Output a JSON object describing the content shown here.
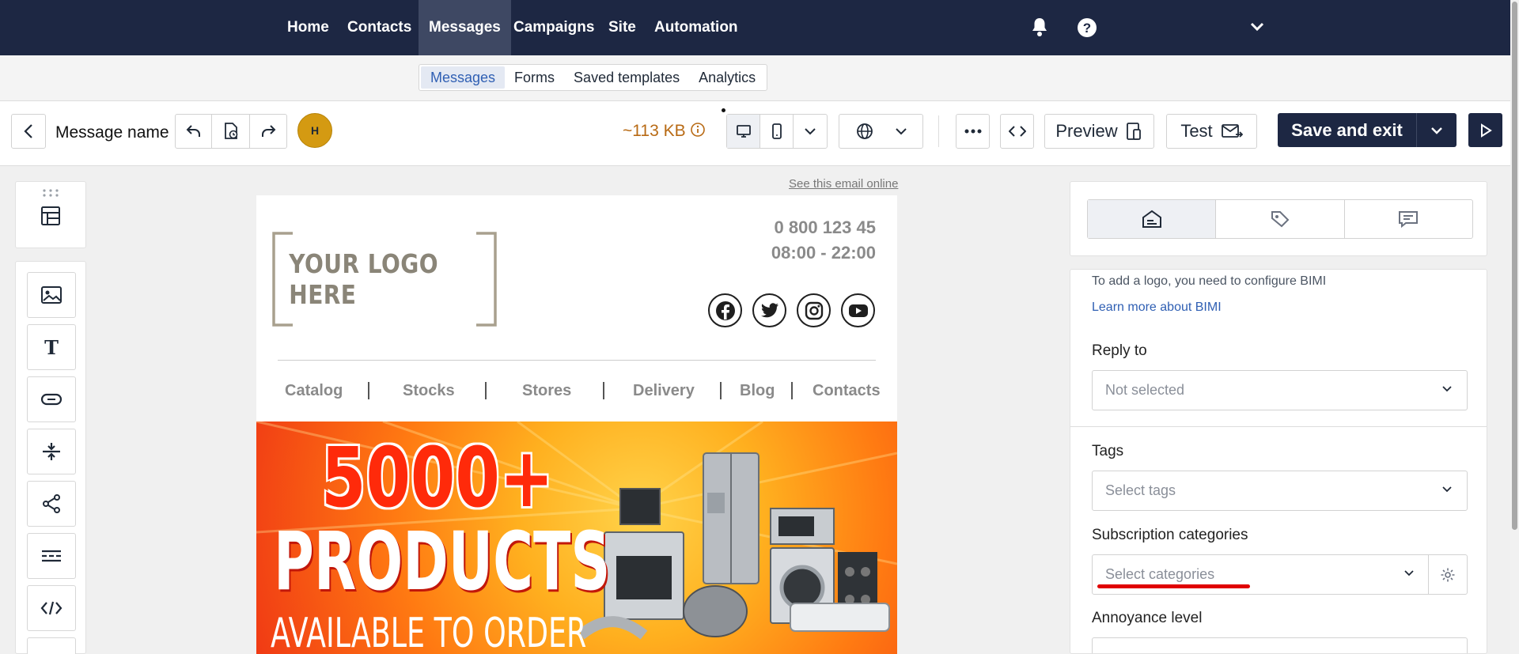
{
  "nav": {
    "items": [
      "Home",
      "Contacts",
      "Messages",
      "Campaigns",
      "Site",
      "Automation"
    ],
    "active": "Messages"
  },
  "subnav": {
    "items": [
      "Messages",
      "Forms",
      "Saved templates",
      "Analytics"
    ],
    "active": "Messages"
  },
  "toolbar": {
    "message_name": "Message name",
    "avatar_initial": "H",
    "size": "~113 KB",
    "preview_label": "Preview",
    "test_label": "Test",
    "save_label": "Save and exit"
  },
  "canvas": {
    "see_online": "See this email online",
    "logo_text": "YOUR LOGO HERE",
    "phone": "0 800 123 45",
    "hours": "08:00 - 22:00",
    "menu": [
      "Catalog",
      "Stocks",
      "Stores",
      "Delivery",
      "Blog",
      "Contacts"
    ],
    "banner_line1": "5000+",
    "banner_line2": "PRODUCTS",
    "banner_line3": "AVAILABLE TO ORDER"
  },
  "settings": {
    "bimi_note": "To add a logo, you need to configure BIMI",
    "bimi_link": "Learn more about BIMI",
    "reply_to_label": "Reply to",
    "reply_to_value": "Not selected",
    "tags_label": "Tags",
    "tags_placeholder": "Select tags",
    "subscription_label": "Subscription categories",
    "subscription_placeholder": "Select categories",
    "annoyance_label": "Annoyance level"
  },
  "colors": {
    "nav_bg": "#1d2743",
    "accent_link": "#2f5fb3",
    "size_text": "#b86a14",
    "avatar": "#d49a12",
    "highlight_underline": "#e00000"
  }
}
